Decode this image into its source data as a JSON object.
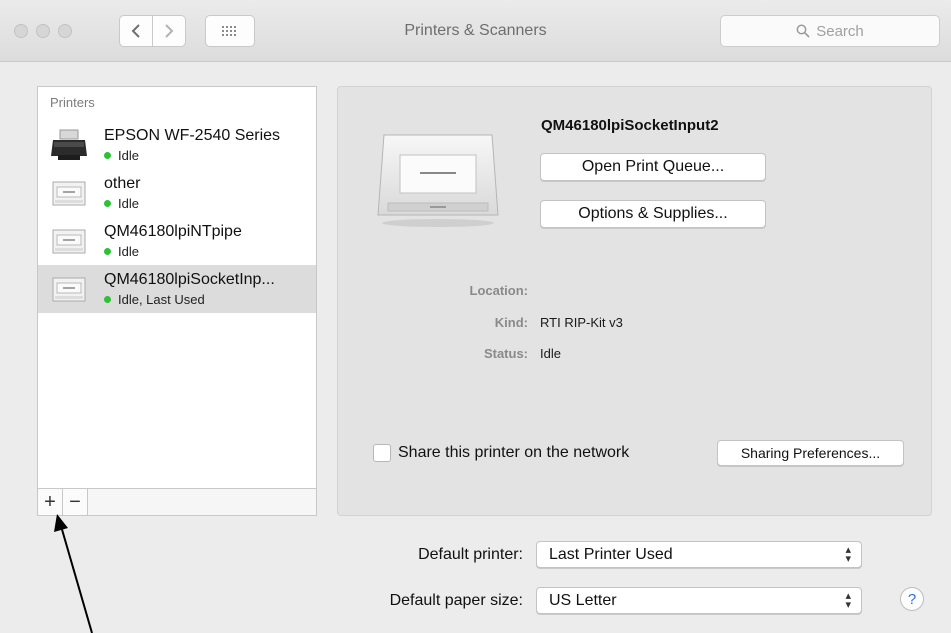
{
  "window": {
    "title": "Printers & Scanners"
  },
  "search": {
    "placeholder": "Search"
  },
  "printers": {
    "header": "Printers",
    "items": [
      {
        "name": "EPSON WF-2540 Series",
        "status": "Idle",
        "icon": "inkjet-printer-icon"
      },
      {
        "name": "other",
        "status": "Idle",
        "icon": "laser-printer-icon"
      },
      {
        "name": "QM46180lpiNTpipe",
        "status": "Idle",
        "icon": "laser-printer-icon"
      },
      {
        "name": "QM46180lpiSocketInp...",
        "status": "Idle, Last Used",
        "icon": "laser-printer-icon",
        "selected": true
      }
    ],
    "add_label": "+",
    "remove_label": "−"
  },
  "detail": {
    "name": "QM46180lpiSocketInput2",
    "open_queue_label": "Open Print Queue...",
    "options_label": "Options & Supplies...",
    "location_label": "Location:",
    "location_value": "",
    "kind_label": "Kind:",
    "kind_value": "RTI RIP-Kit v3",
    "status_label": "Status:",
    "status_value": "Idle",
    "share_label": "Share this printer on the network",
    "share_checked": false,
    "sharing_prefs_label": "Sharing Preferences..."
  },
  "defaults": {
    "printer_label": "Default printer:",
    "printer_value": "Last Printer Used",
    "paper_label": "Default paper size:",
    "paper_value": "US Letter"
  },
  "help_label": "?",
  "colors": {
    "status_dot": "#2fbf3a",
    "help_accent": "#2b6fe0"
  }
}
